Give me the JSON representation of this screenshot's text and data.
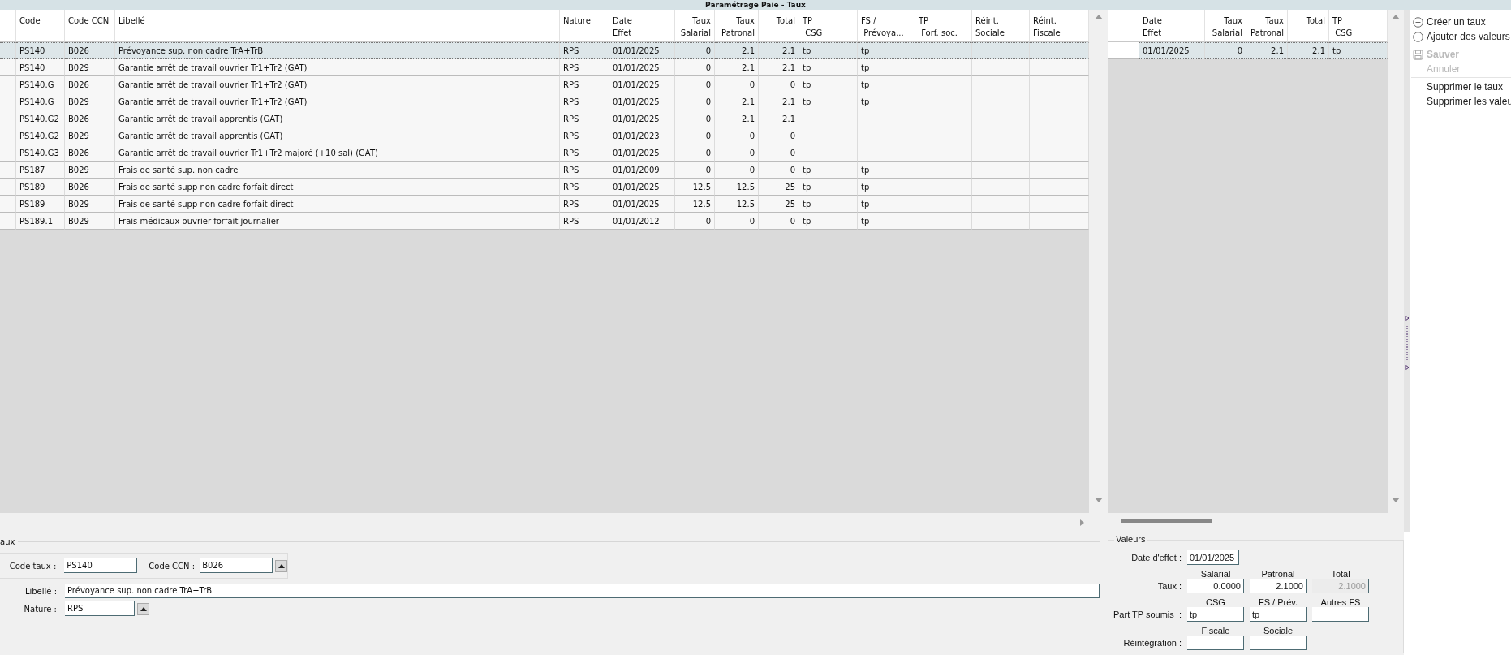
{
  "window": {
    "title": "Paramétrage Paie - Taux"
  },
  "main_table": {
    "columns": [
      {
        "label": "Code",
        "numeric": false
      },
      {
        "label": "Code CCN",
        "numeric": false
      },
      {
        "label": "Libellé",
        "numeric": false
      },
      {
        "label": "Nature",
        "numeric": false
      },
      {
        "label": "Date\nEffet",
        "numeric": false
      },
      {
        "label": "Taux\nSalarial",
        "numeric": true
      },
      {
        "label": "Taux\nPatronal",
        "numeric": true
      },
      {
        "label": "Total",
        "numeric": true
      },
      {
        "label": "TP\n CSG",
        "numeric": false
      },
      {
        "label": "FS /\n Prévoya...",
        "numeric": false
      },
      {
        "label": "TP\n Forf. soc.",
        "numeric": false
      },
      {
        "label": "Réint.\nSociale",
        "numeric": false
      },
      {
        "label": "Réint.\nFiscale",
        "numeric": false
      }
    ],
    "rows": [
      {
        "selected": true,
        "cells": [
          "PS140",
          "B026",
          "Prévoyance sup. non cadre TrA+TrB",
          "RPS",
          "01/01/2025",
          "0",
          "2.1",
          "2.1",
          "tp",
          "tp",
          null,
          null,
          null
        ]
      },
      {
        "selected": false,
        "cells": [
          "PS140",
          "B029",
          "Garantie arrêt de travail ouvrier Tr1+Tr2 (GAT)",
          "RPS",
          "01/01/2025",
          "0",
          "2.1",
          "2.1",
          "tp",
          "tp",
          null,
          null,
          null
        ]
      },
      {
        "selected": false,
        "cells": [
          "PS140.G",
          "B026",
          "Garantie arrêt de travail ouvrier Tr1+Tr2 (GAT)",
          "RPS",
          "01/01/2025",
          "0",
          "0",
          "0",
          "tp",
          "tp",
          null,
          null,
          null
        ]
      },
      {
        "selected": false,
        "cells": [
          "PS140.G",
          "B029",
          "Garantie arrêt de travail ouvrier Tr1+Tr2 (GAT)",
          "RPS",
          "01/01/2025",
          "0",
          "2.1",
          "2.1",
          "tp",
          "tp",
          null,
          null,
          null
        ]
      },
      {
        "selected": false,
        "cells": [
          "PS140.G2",
          "B026",
          "Garantie arrêt de travail apprentis (GAT)",
          "RPS",
          "01/01/2025",
          "0",
          "2.1",
          "2.1",
          null,
          null,
          null,
          null,
          null
        ]
      },
      {
        "selected": false,
        "cells": [
          "PS140.G2",
          "B029",
          "Garantie arrêt de travail apprentis (GAT)",
          "RPS",
          "01/01/2023",
          "0",
          "0",
          "0",
          null,
          null,
          null,
          null,
          null
        ]
      },
      {
        "selected": false,
        "cells": [
          "PS140.G3",
          "B026",
          "Garantie arrêt de travail ouvrier Tr1+Tr2  majoré (+10 sal) (GAT)",
          "RPS",
          "01/01/2025",
          "0",
          "0",
          "0",
          null,
          null,
          null,
          null,
          null
        ]
      },
      {
        "selected": false,
        "cells": [
          "PS187",
          "B029",
          "Frais de santé sup. non cadre",
          "RPS",
          "01/01/2009",
          "0",
          "0",
          "0",
          "tp",
          "tp",
          null,
          null,
          null
        ]
      },
      {
        "selected": false,
        "cells": [
          "PS189",
          "B026",
          "Frais de santé supp non cadre forfait direct",
          "RPS",
          "01/01/2025",
          "12.5",
          "12.5",
          "25",
          "tp",
          "tp",
          null,
          null,
          null
        ]
      },
      {
        "selected": false,
        "cells": [
          "PS189",
          "B029",
          "Frais de santé supp non cadre forfait direct",
          "RPS",
          "01/01/2025",
          "12.5",
          "12.5",
          "25",
          "tp",
          "tp",
          null,
          null,
          null
        ]
      },
      {
        "selected": false,
        "cells": [
          "PS189.1",
          "B029",
          "Frais médicaux ouvrier forfait journalier",
          "RPS",
          "01/01/2012",
          "0",
          "0",
          "0",
          "tp",
          "tp",
          null,
          null,
          null
        ]
      }
    ]
  },
  "values_table": {
    "columns": [
      {
        "label": "Date\nEffet",
        "numeric": false
      },
      {
        "label": "Taux\nSalarial",
        "numeric": true
      },
      {
        "label": "Taux\nPatronal",
        "numeric": true
      },
      {
        "label": "Total",
        "numeric": true
      },
      {
        "label": "TP\n CSG",
        "numeric": false
      }
    ],
    "rows": [
      {
        "selected": true,
        "cells": [
          "01/01/2025",
          "0",
          "2.1",
          "2.1",
          "tp"
        ]
      }
    ]
  },
  "menu": {
    "groups": [
      [
        {
          "label": "Créer un taux",
          "kind": "add",
          "disabled": false
        },
        {
          "label": "Ajouter des valeurs",
          "kind": "add",
          "disabled": false
        }
      ],
      [
        {
          "label": "Sauver",
          "kind": "save",
          "disabled": true
        },
        {
          "label": "Annuler",
          "kind": "plain",
          "disabled": true
        }
      ],
      [
        {
          "label": "Supprimer le taux",
          "kind": "plain",
          "disabled": false
        },
        {
          "label": "Supprimer les valeu",
          "kind": "plain",
          "disabled": false
        }
      ]
    ]
  },
  "taux_form": {
    "legend": "aux",
    "code_taux": {
      "label": "Code taux :",
      "value": "PS140"
    },
    "code_ccn": {
      "label": "Code CCN :",
      "value": "B026"
    },
    "libelle": {
      "label": "Libellé :",
      "value": "Prévoyance sup. non cadre TrA+TrB"
    },
    "nature": {
      "label": "Nature :",
      "value": "RPS"
    }
  },
  "valeurs": {
    "legend": "Valeurs",
    "date": {
      "label": "Date d'effet :",
      "value": "01/01/2025"
    },
    "grid": [
      {
        "label": "Taux :",
        "heads": [
          "Salarial",
          "Patronal",
          "Total"
        ],
        "fields": [
          {
            "value": "0.0000",
            "numeric": true,
            "disabled": false
          },
          {
            "value": "2.1000",
            "numeric": true,
            "disabled": false
          },
          {
            "value": "2.1000",
            "numeric": true,
            "disabled": true
          }
        ]
      },
      {
        "label": "Part TP soumis  :",
        "heads": [
          "CSG",
          "FS / Prév.",
          "Autres FS"
        ],
        "fields": [
          {
            "value": "tp",
            "numeric": false,
            "disabled": false
          },
          {
            "value": "tp",
            "numeric": false,
            "disabled": false
          },
          {
            "disabled": false
          }
        ]
      },
      {
        "label": "Réintégration :",
        "heads": [
          "Fiscale",
          "Sociale"
        ],
        "fields": [
          {
            "disabled": false
          },
          {
            "disabled": false
          }
        ]
      }
    ]
  }
}
